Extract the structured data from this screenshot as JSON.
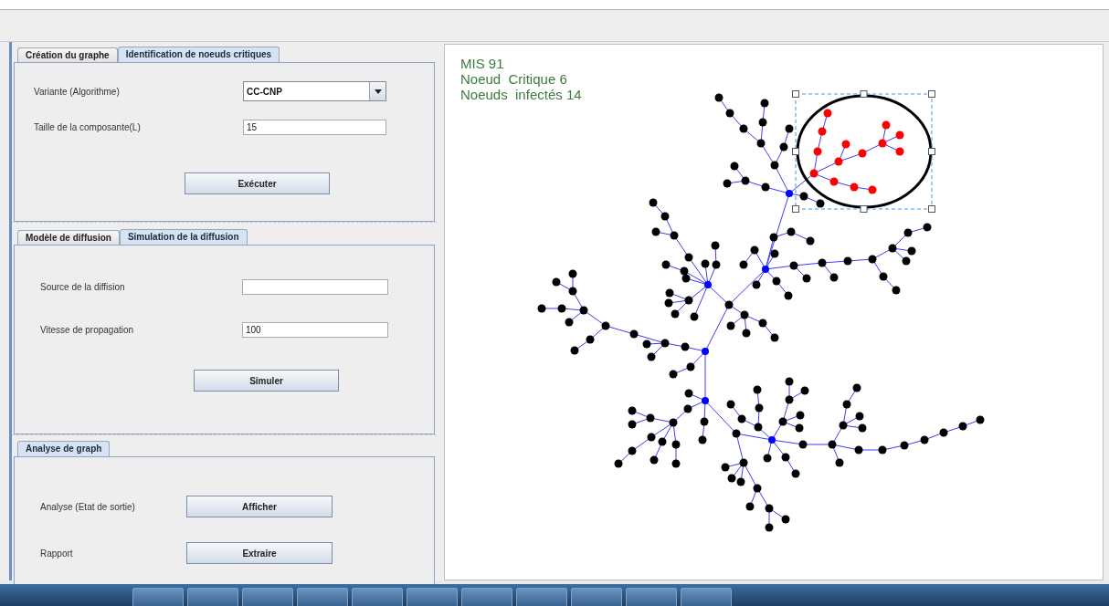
{
  "panels": [
    {
      "tabs": [
        {
          "label": "Création du graphe",
          "selected": false
        },
        {
          "label": "Identification de noeuds critiques",
          "selected": true
        }
      ],
      "rows": [
        {
          "kind": "dropdown",
          "label": "Variante (Algorithme)",
          "value": "CC-CNP"
        },
        {
          "kind": "text_field",
          "label": "Taille de la composante(L)",
          "value": "15"
        }
      ],
      "button": "Exécuter"
    },
    {
      "tabs": [
        {
          "label": "Modèle de diffusion",
          "selected": false
        },
        {
          "label": "Simulation de la diffusion",
          "selected": true
        }
      ],
      "rows": [
        {
          "kind": "text_field",
          "label": "Source de la diffision",
          "value": ""
        },
        {
          "kind": "text_field",
          "label": "Vitesse de propagation",
          "value": "100"
        }
      ],
      "button": "Simuler"
    },
    {
      "tabs": [
        {
          "label": "Analyse de graph",
          "selected": true
        }
      ],
      "rows": [
        {
          "kind": "button",
          "label": "Analyse (Etat de sortie)",
          "value": "Afficher"
        },
        {
          "kind": "button",
          "label": "Rapport",
          "value": "Extraire"
        }
      ]
    }
  ],
  "canvas": {
    "stats": [
      "MIS 91",
      "Noeud  Critique 6",
      "Noeuds  infectés 14"
    ]
  }
}
